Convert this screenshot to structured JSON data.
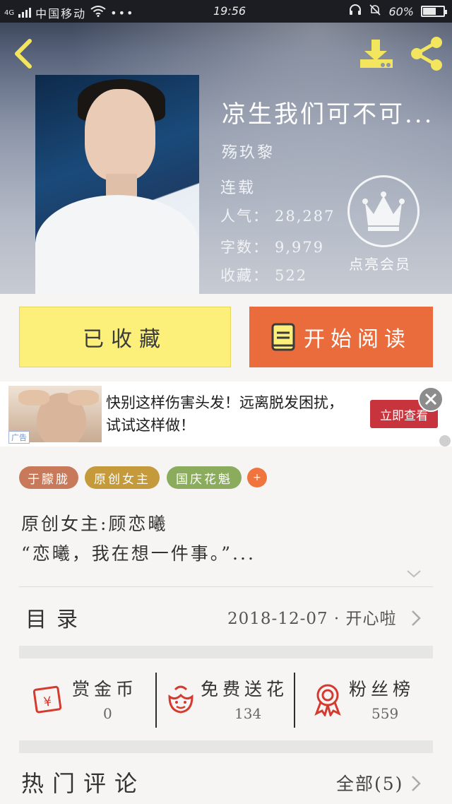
{
  "status_bar": {
    "network": "4G",
    "carrier": "中国移动",
    "time": "19:56",
    "battery": "60%",
    "battery_level": 0.6
  },
  "book": {
    "title": "凉生我们可不可...",
    "author": "殇玖黎",
    "status": "连载",
    "popularity_label": "人气：",
    "popularity": "28,287",
    "word_count_label": "字数：",
    "word_count": "9,979",
    "favorites_label": "收藏：",
    "favorites": "522"
  },
  "vip": {
    "label": "点亮会员"
  },
  "actions": {
    "collected_label": "已收藏",
    "read_label": "开始阅读"
  },
  "ad": {
    "tag": "广告",
    "text": "快别这样伤害头发！远离脱发困扰，试试这样做！",
    "cta": "立即查看"
  },
  "tags": [
    {
      "label": "于朦胧",
      "color": "#c8795a"
    },
    {
      "label": "原创女主",
      "color": "#c59a3b"
    },
    {
      "label": "国庆花魁",
      "color": "#8bac5d"
    }
  ],
  "tag_add_label": "+",
  "description": {
    "line1": "原创女主:顾恋曦",
    "line2": "“恋曦，我在想一件事。”..."
  },
  "toc": {
    "label": "目录",
    "latest": "2018-12-07 · 开心啦"
  },
  "rewards": [
    {
      "label": "赏金币",
      "value": "0",
      "icon": "red-envelope-icon"
    },
    {
      "label": "免费送花",
      "value": "134",
      "icon": "flower-icon"
    },
    {
      "label": "粉丝榜",
      "value": "559",
      "icon": "medal-icon"
    }
  ],
  "comments": {
    "label": "热门评论",
    "all_label": "全部(5)"
  },
  "colors": {
    "accent_orange": "#ea6c3c",
    "collected_yellow": "#fcf07a",
    "icon_yellow": "#f3e55e",
    "reward_red": "#d53a2f"
  }
}
